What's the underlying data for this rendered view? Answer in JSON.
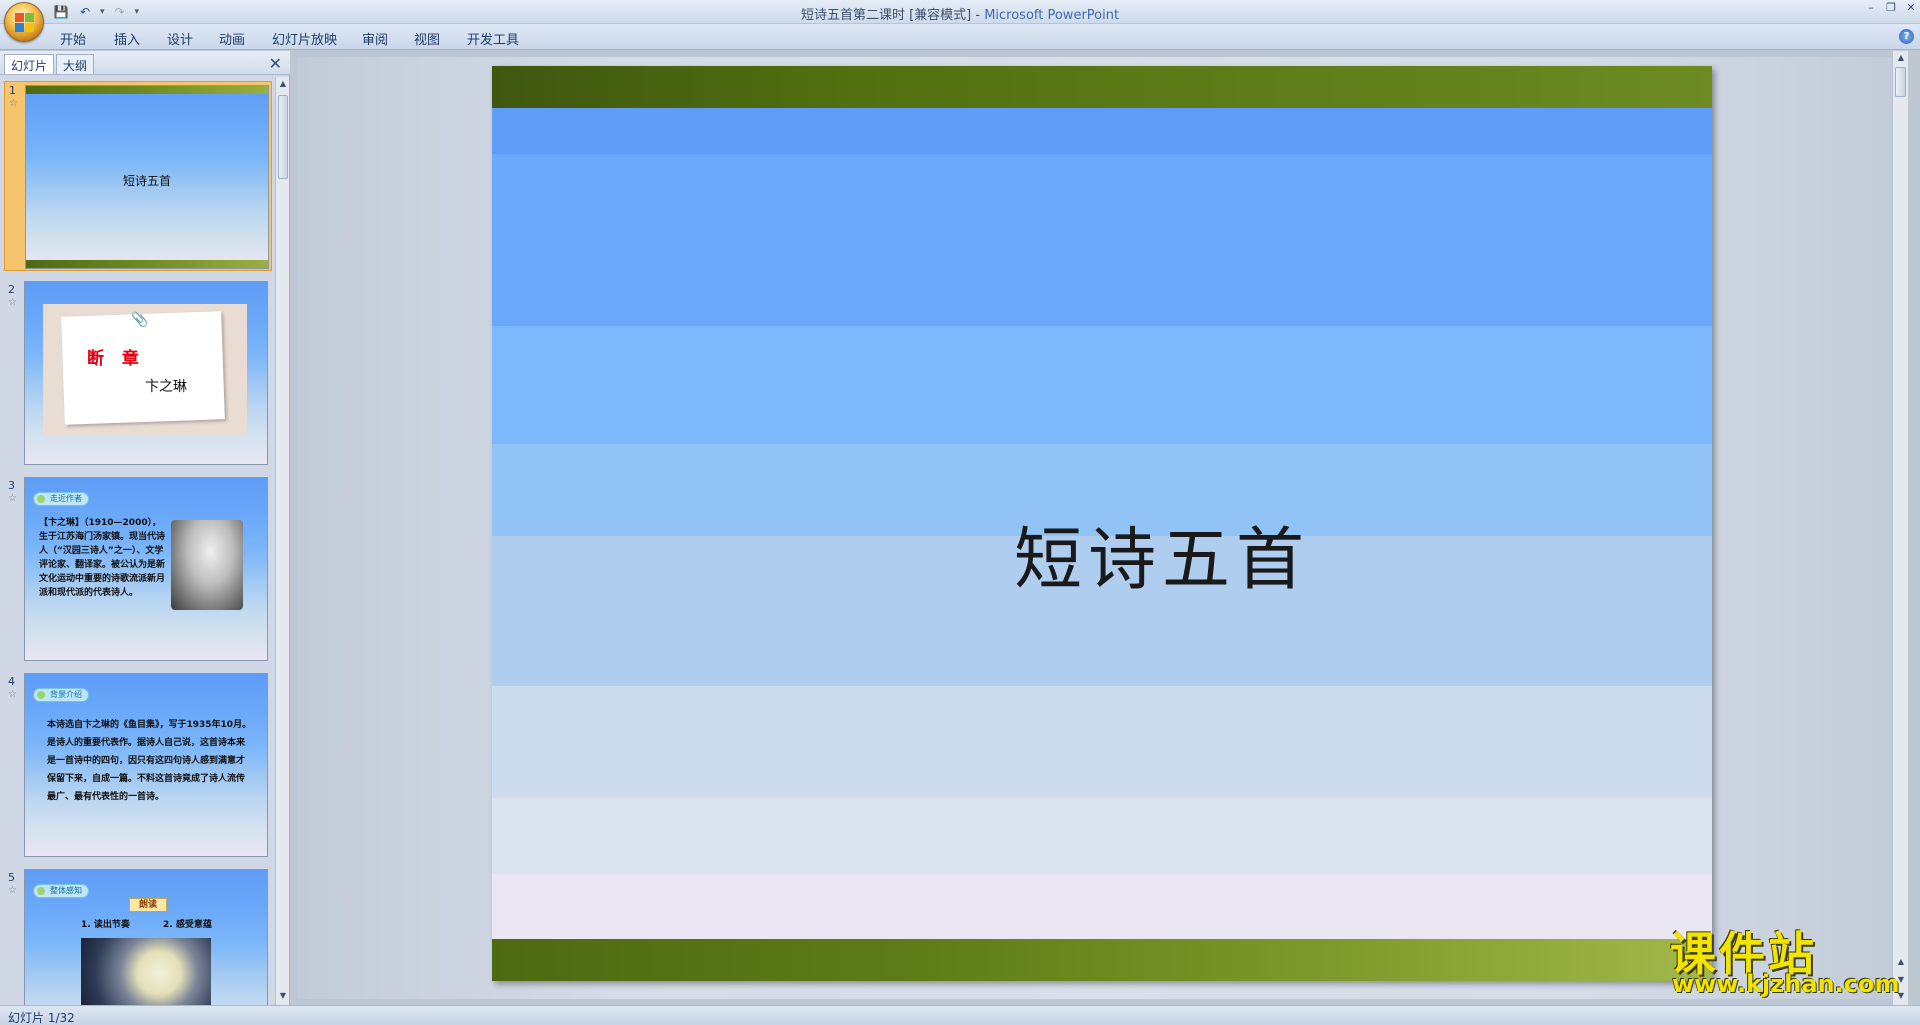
{
  "window": {
    "title": "短诗五首第二课时 [兼容模式]",
    "title_sep": " - ",
    "app_name": "Microsoft PowerPoint"
  },
  "ribbon": {
    "tabs": [
      "开始",
      "插入",
      "设计",
      "动画",
      "幻灯片放映",
      "审阅",
      "视图",
      "开发工具"
    ]
  },
  "panel": {
    "tabs": [
      "幻灯片",
      "大纲"
    ]
  },
  "thumbnails": [
    {
      "num": "1",
      "title": "短诗五首"
    },
    {
      "num": "2",
      "title": "断 章",
      "author": "卞之琳"
    },
    {
      "num": "3",
      "section": "走近作者",
      "text": "【卞之琳】（1910—2000），生于江苏海门汤家镇。现当代诗人（“汉园三诗人”之一）、文学评论家、翻译家。被公认为是新文化运动中重要的诗歌流派新月派和现代派的代表诗人。"
    },
    {
      "num": "4",
      "section": "背景介绍",
      "text": "本诗选自卞之琳的《鱼目集》，写于1935年10月。是诗人的重要代表作。据诗人自己说，这首诗本来是一首诗中的四句，因只有这四句诗人感到满意才保留下来，自成一篇。不料这首诗竟成了诗人流传最广、最有代表性的一首诗。"
    },
    {
      "num": "5",
      "section": "整体感知",
      "label_box": "朗读",
      "items": [
        "1. 读出节奏",
        "2. 感受意蕴"
      ]
    }
  ],
  "slide": {
    "title": "短诗五首"
  },
  "status": {
    "text": "幻灯片 1/32"
  },
  "watermark": {
    "title": "课件站",
    "url": "www.kjzhan.com"
  },
  "colors": {
    "accent_green": "#52700f",
    "slide_blue_top": "#5f9cf7",
    "selection_orange": "#f5c56d",
    "title_red": "#e60012"
  }
}
